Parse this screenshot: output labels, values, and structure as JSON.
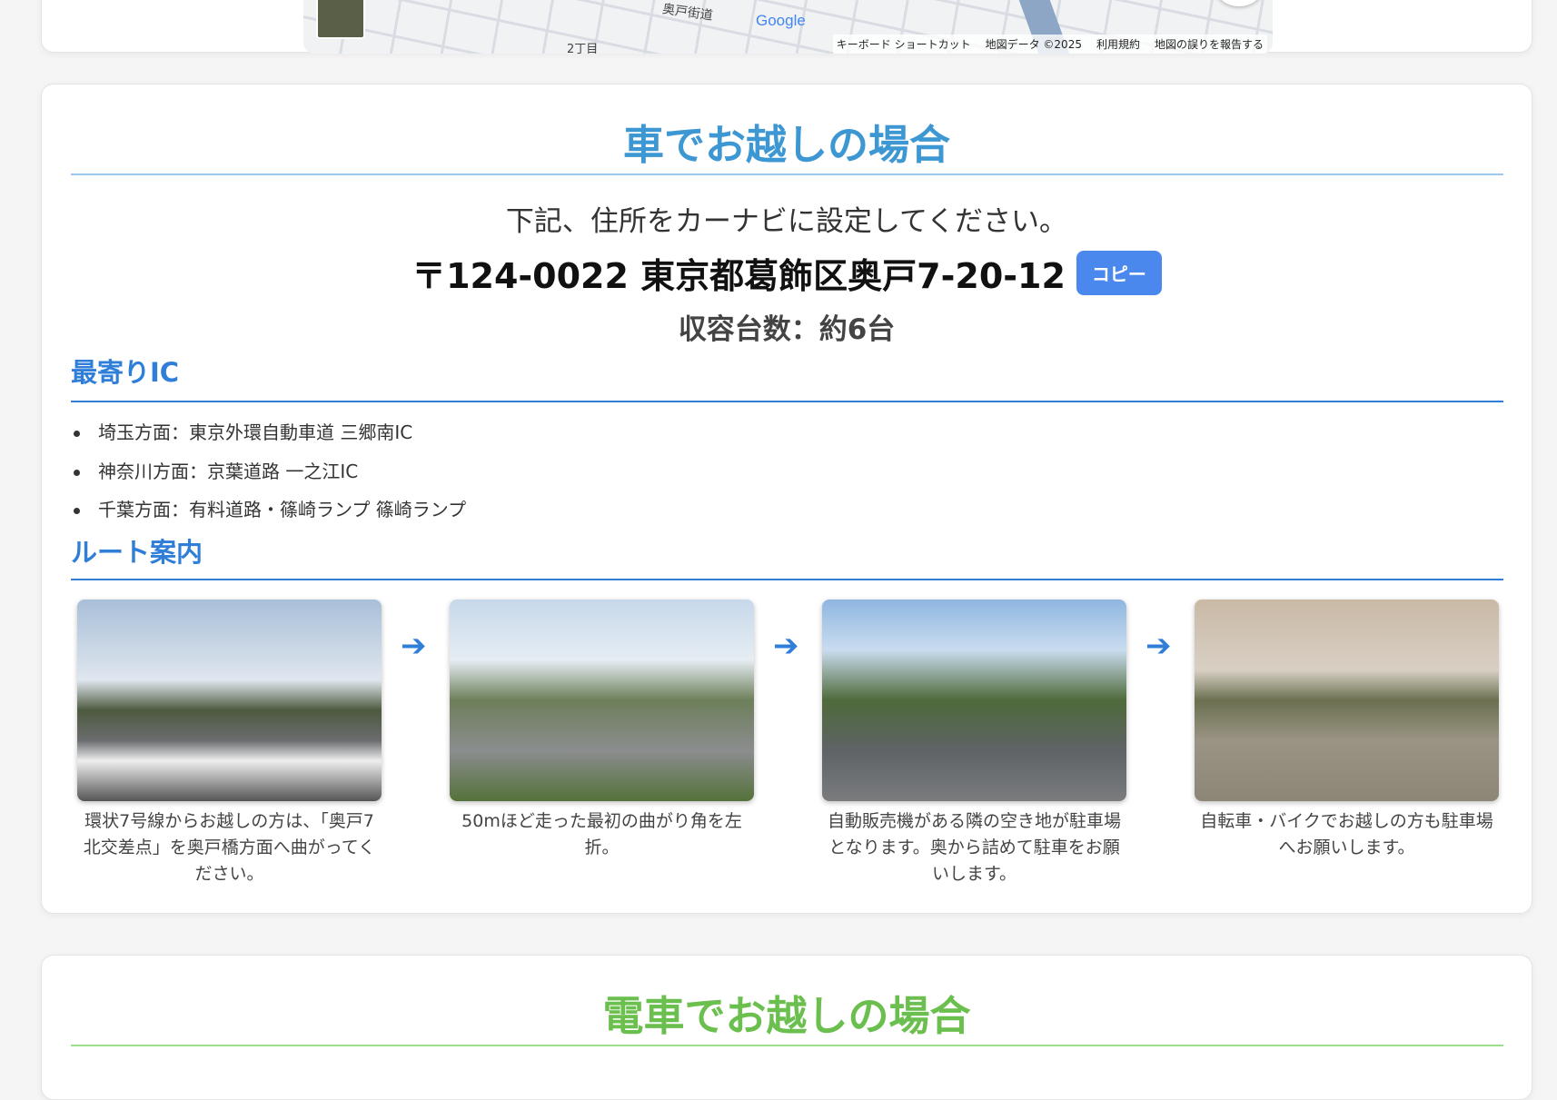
{
  "map": {
    "street_label": "奥戸街道",
    "area_label": "2丁目",
    "logo": "Google",
    "attribution": [
      "キーボード ショートカット",
      "地図データ ©2025",
      "利用規約",
      "地図の誤りを報告する"
    ]
  },
  "car": {
    "title": "車でお越しの場合",
    "intro": "下記、住所をカーナビに設定してください。",
    "address": "〒124-0022 東京都葛飾区奥戸7-20-12",
    "copy_label": "コピー",
    "capacity": "収容台数：約6台",
    "ic_heading": "最寄りIC",
    "ic_items": [
      "埼玉方面：東京外環自動車道 三郷南IC",
      "神奈川方面：京葉道路 一之江IC",
      "千葉方面：有料道路・篠崎ランプ 篠崎ランプ"
    ],
    "route_heading": "ルート案内",
    "steps": [
      {
        "caption": "環状7号線からお越しの方は、「奥戸7北交差点」を奥戸橋方面へ曲がってください。"
      },
      {
        "caption": "50mほど走った最初の曲がり角を左折。"
      },
      {
        "caption": "自動販売機がある隣の空き地が駐車場となります。奥から詰めて駐車をお願いします。"
      },
      {
        "caption": "自転車・バイクでお越しの方も駐車場へお願いします。"
      }
    ]
  },
  "train": {
    "title": "電車でお越しの場合"
  },
  "colors": {
    "accent": "#2f7ed8",
    "car_title": "#3d97d3",
    "train_title": "#6bbf4e",
    "copy_button": "#4a88ee"
  }
}
